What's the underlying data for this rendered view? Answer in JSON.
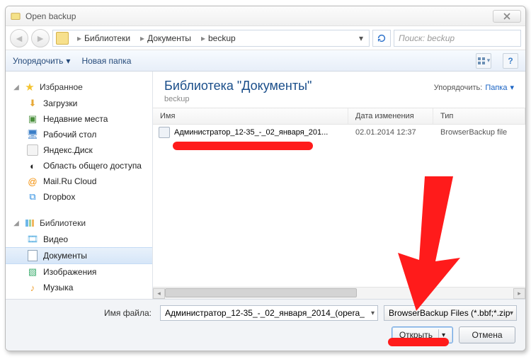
{
  "window": {
    "title": "Open backup"
  },
  "nav": {
    "breadcrumb": [
      "Библиотеки",
      "Документы",
      "beckup"
    ],
    "search_placeholder": "Поиск: beckup"
  },
  "toolbar": {
    "organize": "Упорядочить",
    "new_folder": "Новая папка"
  },
  "sidebar": {
    "favorites": {
      "label": "Избранное",
      "items": [
        {
          "icon": "downloads-icon",
          "label": "Загрузки"
        },
        {
          "icon": "recent-places-icon",
          "label": "Недавние места"
        },
        {
          "icon": "desktop-icon",
          "label": "Рабочий стол"
        },
        {
          "icon": "yandex-disk-icon",
          "label": "Яндекс.Диск"
        },
        {
          "icon": "shared-area-icon",
          "label": "Область общего доступа"
        },
        {
          "icon": "mailru-cloud-icon",
          "label": "Mail.Ru Cloud"
        },
        {
          "icon": "dropbox-icon",
          "label": "Dropbox"
        }
      ]
    },
    "libraries": {
      "label": "Библиотеки",
      "items": [
        {
          "icon": "video-library-icon",
          "label": "Видео",
          "selected": false
        },
        {
          "icon": "documents-library-icon",
          "label": "Документы",
          "selected": true
        },
        {
          "icon": "pictures-library-icon",
          "label": "Изображения",
          "selected": false
        },
        {
          "icon": "music-library-icon",
          "label": "Музыка",
          "selected": false
        }
      ]
    }
  },
  "main": {
    "library_title": "Библиотека \"Документы\"",
    "library_subtitle": "beckup",
    "sort_label": "Упорядочить:",
    "sort_value": "Папка",
    "columns": {
      "name": "Имя",
      "modified": "Дата изменения",
      "type": "Тип"
    },
    "files": [
      {
        "name": "Администратор_12-35_-_02_января_201...",
        "modified": "02.01.2014 12:37",
        "type": "BrowserBackup file"
      }
    ]
  },
  "footer": {
    "filename_label": "Имя файла:",
    "filename_value": "Администратор_12-35_-_02_января_2014_(opera_",
    "filter_value": "BrowserBackup Files (*.bbf;*.zip",
    "open": "Открыть",
    "cancel": "Отмена"
  }
}
